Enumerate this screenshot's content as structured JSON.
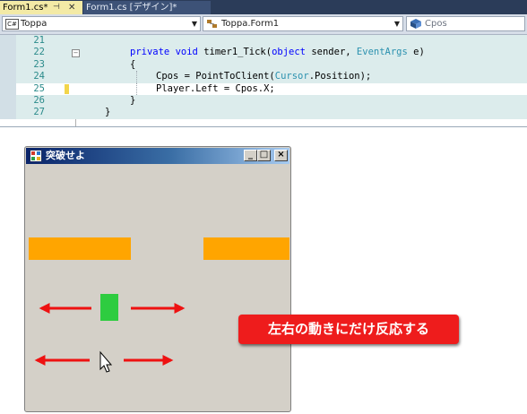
{
  "ide": {
    "tabs": [
      {
        "label": "Form1.cs*",
        "active": true
      },
      {
        "label": "Form1.cs [デザイン]*",
        "active": false
      }
    ],
    "nav": {
      "class_combo": "Toppa",
      "type_combo": "Toppa.Form1",
      "member_combo": "Cpos"
    },
    "lines": [
      {
        "num": "21",
        "code": ""
      },
      {
        "num": "22",
        "code": "private void timer1_Tick(object sender, EventArgs e)"
      },
      {
        "num": "23",
        "code": "{"
      },
      {
        "num": "24",
        "code": "Cpos = PointToClient(Cursor.Position);"
      },
      {
        "num": "25",
        "code": "Player.Left = Cpos.X;"
      },
      {
        "num": "26",
        "code": "}"
      },
      {
        "num": "27",
        "code": "}"
      }
    ],
    "highlighted_line": "25"
  },
  "form": {
    "title": "突破せよ",
    "buttons": {
      "minimize": "_",
      "maximize": "□",
      "close": "×"
    }
  },
  "callout": "左右の動きにだけ反応する",
  "colors": {
    "bar": "#ffa500",
    "player": "#2ecc40",
    "arrow": "#ee1111",
    "callout": "#ee1c1c",
    "form_bg": "#d4d0c8"
  }
}
